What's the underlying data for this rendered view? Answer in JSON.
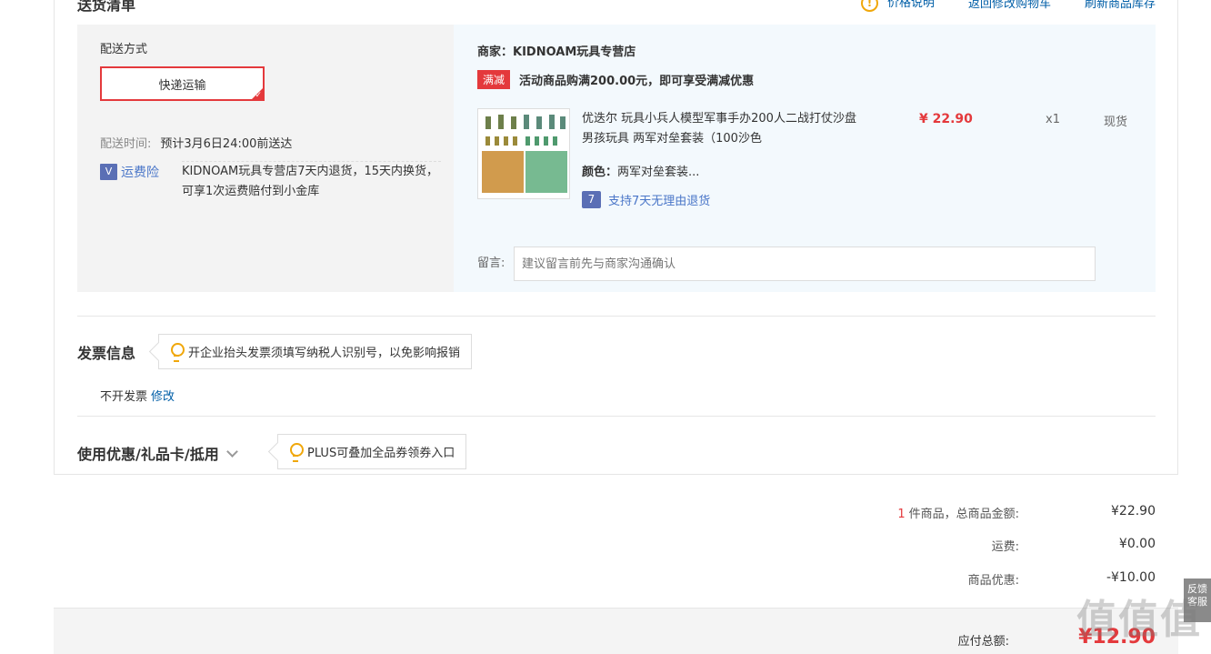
{
  "delivery_list": {
    "title": "送货清单",
    "links": {
      "price_note": "价格说明",
      "back_to_cart": "返回修改购物车",
      "refresh_stock": "刷新商品库存"
    }
  },
  "shipping": {
    "method_title": "配送方式",
    "method_selected": "快递运输",
    "time_label": "配送时间:",
    "time_value": "预计3月6日24:00前送达",
    "insurance_label": "运费险",
    "insurance_text": "KIDNOAM玩具专营店7天内退货，15天内换货，可享1次运费赔付到小金库"
  },
  "goods": {
    "merchant": "商家：KIDNOAM玩具专营店",
    "promo_tag": "满减",
    "promo_text": "活动商品购满200.00元，即可享受满减优惠",
    "name": "优迭尔 玩具小兵人模型军事手办200人二战打仗沙盘男孩玩具 两军对垒套装（100沙色",
    "color_label": "颜色：",
    "color_value": "两军对垒套装...",
    "return_badge": "7",
    "return_text": "支持7天无理由退货",
    "price": "¥ 22.90",
    "quantity": "x1",
    "stock": "现货",
    "message_label": "留言:",
    "message_placeholder": "建议留言前先与商家沟通确认"
  },
  "invoice": {
    "title": "发票信息",
    "tip": "开企业抬头发票须填写纳税人识别号，以免影响报销",
    "value": "不开发票",
    "edit": "修改"
  },
  "coupon": {
    "title": "使用优惠/礼品卡/抵用",
    "tip": "PLUS可叠加全品券领券入口"
  },
  "summary": {
    "count": "1",
    "goods_total_label": "件商品，总商品金额:",
    "goods_total": "¥22.90",
    "freight_label": "运费:",
    "freight": "¥0.00",
    "discount_label": "商品优惠:",
    "discount": "-¥10.00",
    "payable_label": "应付总额:",
    "payable": "¥12.90"
  },
  "side_widget": {
    "line1": "反馈",
    "line2": "客服"
  },
  "watermark": "值值值"
}
